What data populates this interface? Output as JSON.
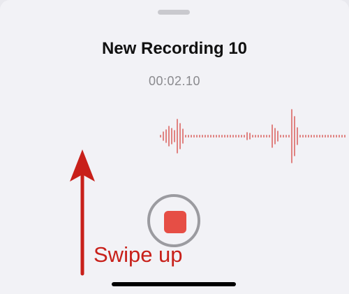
{
  "recording": {
    "title": "New Recording 10",
    "elapsed": "00:02.10"
  },
  "controls": {
    "stop_button_icon": "stop-square-icon"
  },
  "annotation": {
    "text": "Swipe up",
    "arrow_icon": "up-arrow-icon"
  },
  "colors": {
    "accent_red": "#e64e45",
    "annotation_red": "#c8201a",
    "waveform_red": "#d9534f",
    "ring_gray": "#9b9ba0",
    "sheet_bg": "#f2f2f6"
  }
}
